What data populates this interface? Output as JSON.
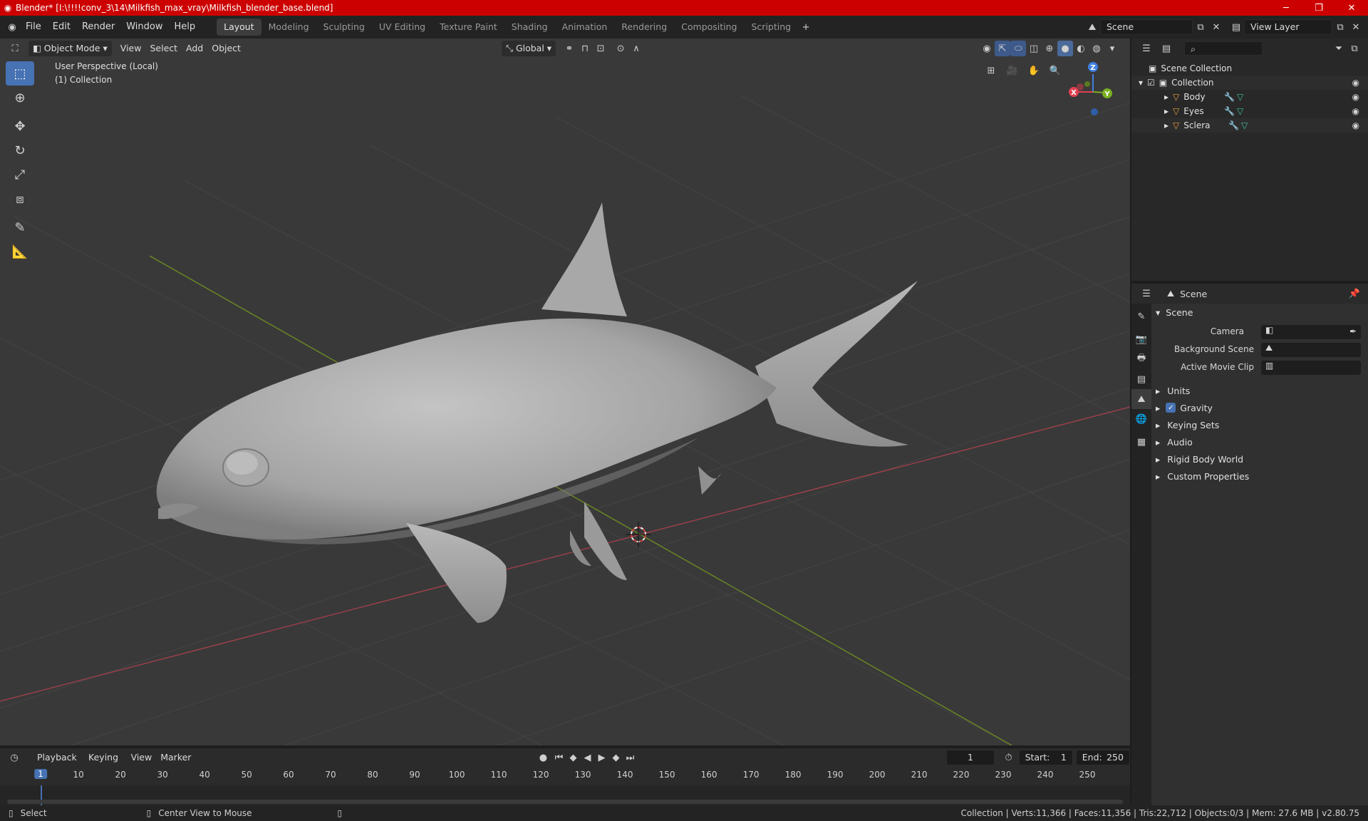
{
  "titlebar": {
    "title": "Blender* [I:\\!!!!conv_3\\14\\Milkfish_max_vray\\Milkfish_blender_base.blend]",
    "minimize": "─",
    "maximize": "❐",
    "close": "✕"
  },
  "menu": {
    "file": "File",
    "edit": "Edit",
    "render": "Render",
    "window": "Window",
    "help": "Help"
  },
  "workspaces": [
    "Layout",
    "Modeling",
    "Sculpting",
    "UV Editing",
    "Texture Paint",
    "Shading",
    "Animation",
    "Rendering",
    "Compositing",
    "Scripting"
  ],
  "active_workspace": "Layout",
  "scene_selector": {
    "value": "Scene"
  },
  "view_layer_selector": {
    "value": "View Layer"
  },
  "viewport_header": {
    "mode": "Object Mode",
    "view": "View",
    "select": "Select",
    "add": "Add",
    "object": "Object",
    "orientation": "Global"
  },
  "viewport": {
    "perspective": "User Perspective (Local)",
    "collection": "(1) Collection",
    "gizmo": {
      "x": "X",
      "y": "Y",
      "z": "Z"
    }
  },
  "outliner": {
    "root": "Scene Collection",
    "collection": "Collection",
    "objects": [
      "Body",
      "Eyes",
      "Sclera"
    ]
  },
  "properties": {
    "context": "Scene",
    "panel_title": "Scene",
    "camera_label": "Camera",
    "background_scene_label": "Background Scene",
    "active_movie_clip_label": "Active Movie Clip",
    "sections": [
      "Units",
      "Gravity",
      "Keying Sets",
      "Audio",
      "Rigid Body World",
      "Custom Properties"
    ],
    "gravity_checked": true
  },
  "timeline": {
    "playback": "Playback",
    "keying": "Keying",
    "view": "View",
    "marker": "Marker",
    "current_frame": "1",
    "start_label": "Start:",
    "start": "1",
    "end_label": "End:",
    "end": "250",
    "ruler_ticks": [
      "1",
      "10",
      "20",
      "30",
      "40",
      "50",
      "60",
      "70",
      "80",
      "90",
      "100",
      "110",
      "120",
      "130",
      "140",
      "150",
      "160",
      "170",
      "180",
      "190",
      "200",
      "210",
      "220",
      "230",
      "240",
      "250"
    ]
  },
  "statusbar": {
    "select": "Select",
    "center_view": "Center View to Mouse",
    "stats": "Collection | Verts:11,366 | Faces:11,356 | Tris:22,712 | Objects:0/3 | Mem: 27.6 MB | v2.80.75"
  },
  "colors": {
    "title_bar": "#cc0000",
    "accent": "#4772b3",
    "x_axis": "#e04050",
    "y_axis": "#7ab020",
    "z_axis": "#3f7fe0",
    "mesh_icon": "#e8a040"
  }
}
